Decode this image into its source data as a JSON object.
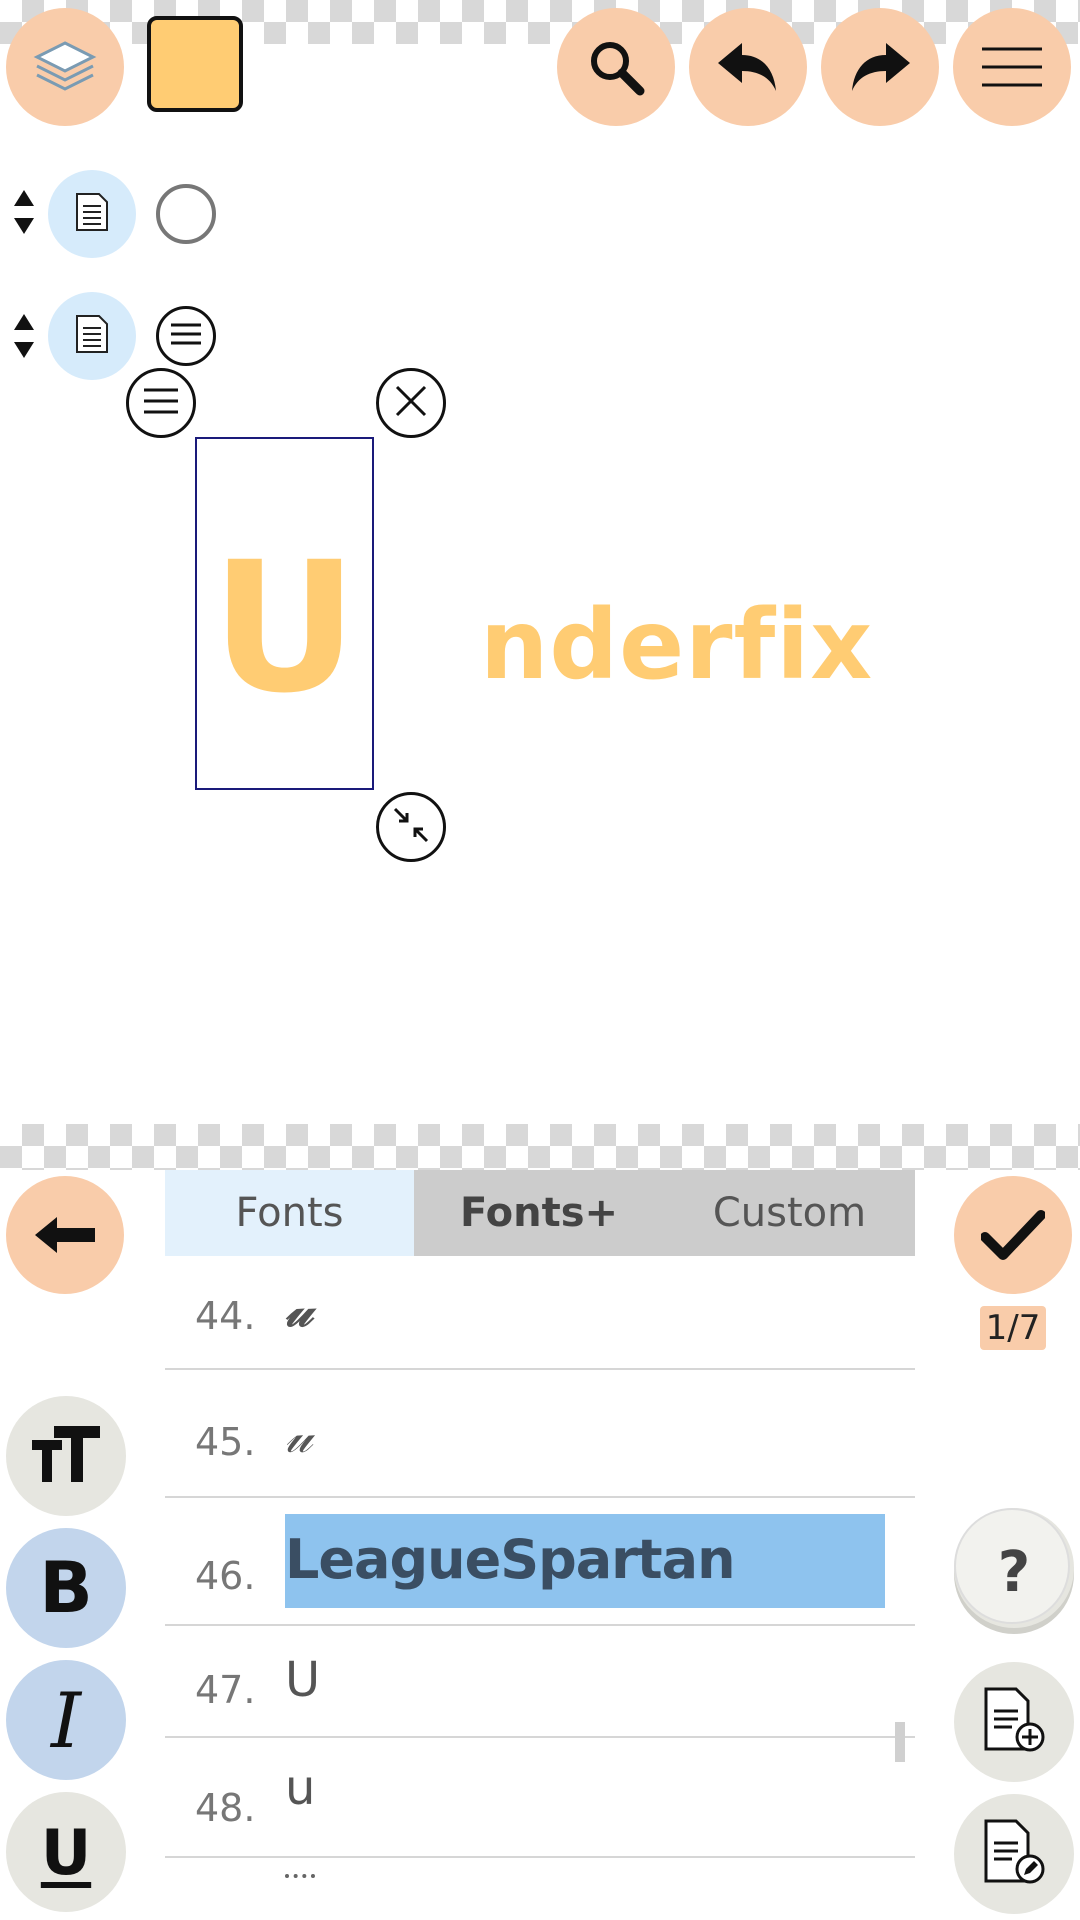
{
  "colors": {
    "accent_peach": "#f9ccaa",
    "swatch_yellow": "#ffcc73",
    "tab_active_bg": "#e3f1fc",
    "tab_inactive_bg": "#cccccc",
    "selected_row_bg": "#8ec3ee",
    "style_button_blue": "#c2d5ec",
    "style_button_grey": "#e6e6e0"
  },
  "canvas": {
    "selected_letter": "U",
    "rest_text": "nderfix"
  },
  "tabs": [
    {
      "label": "Fonts",
      "active": true
    },
    {
      "label": "Fonts+",
      "active": false
    },
    {
      "label": "Custom",
      "active": false
    }
  ],
  "font_list": [
    {
      "number": "44.",
      "preview": "𝓊"
    },
    {
      "number": "45.",
      "preview": "𝓊"
    },
    {
      "number": "46.",
      "preview": "LeagueSpartan",
      "selected": true
    },
    {
      "number": "47.",
      "preview": "U"
    },
    {
      "number": "48.",
      "preview": "u"
    }
  ],
  "page_indicator": "1/7",
  "help_label": "?",
  "style_buttons": {
    "bold": "B",
    "italic": "I",
    "underline": "U"
  },
  "icons": {
    "layers": "layers-icon",
    "search": "search-icon",
    "undo": "undo-icon",
    "redo": "redo-icon",
    "menu": "menu-icon",
    "back": "arrow-left-icon",
    "confirm": "checkmark-icon",
    "text_size": "text-size-icon",
    "add_page": "add-document-icon",
    "edit_page": "edit-document-icon"
  }
}
